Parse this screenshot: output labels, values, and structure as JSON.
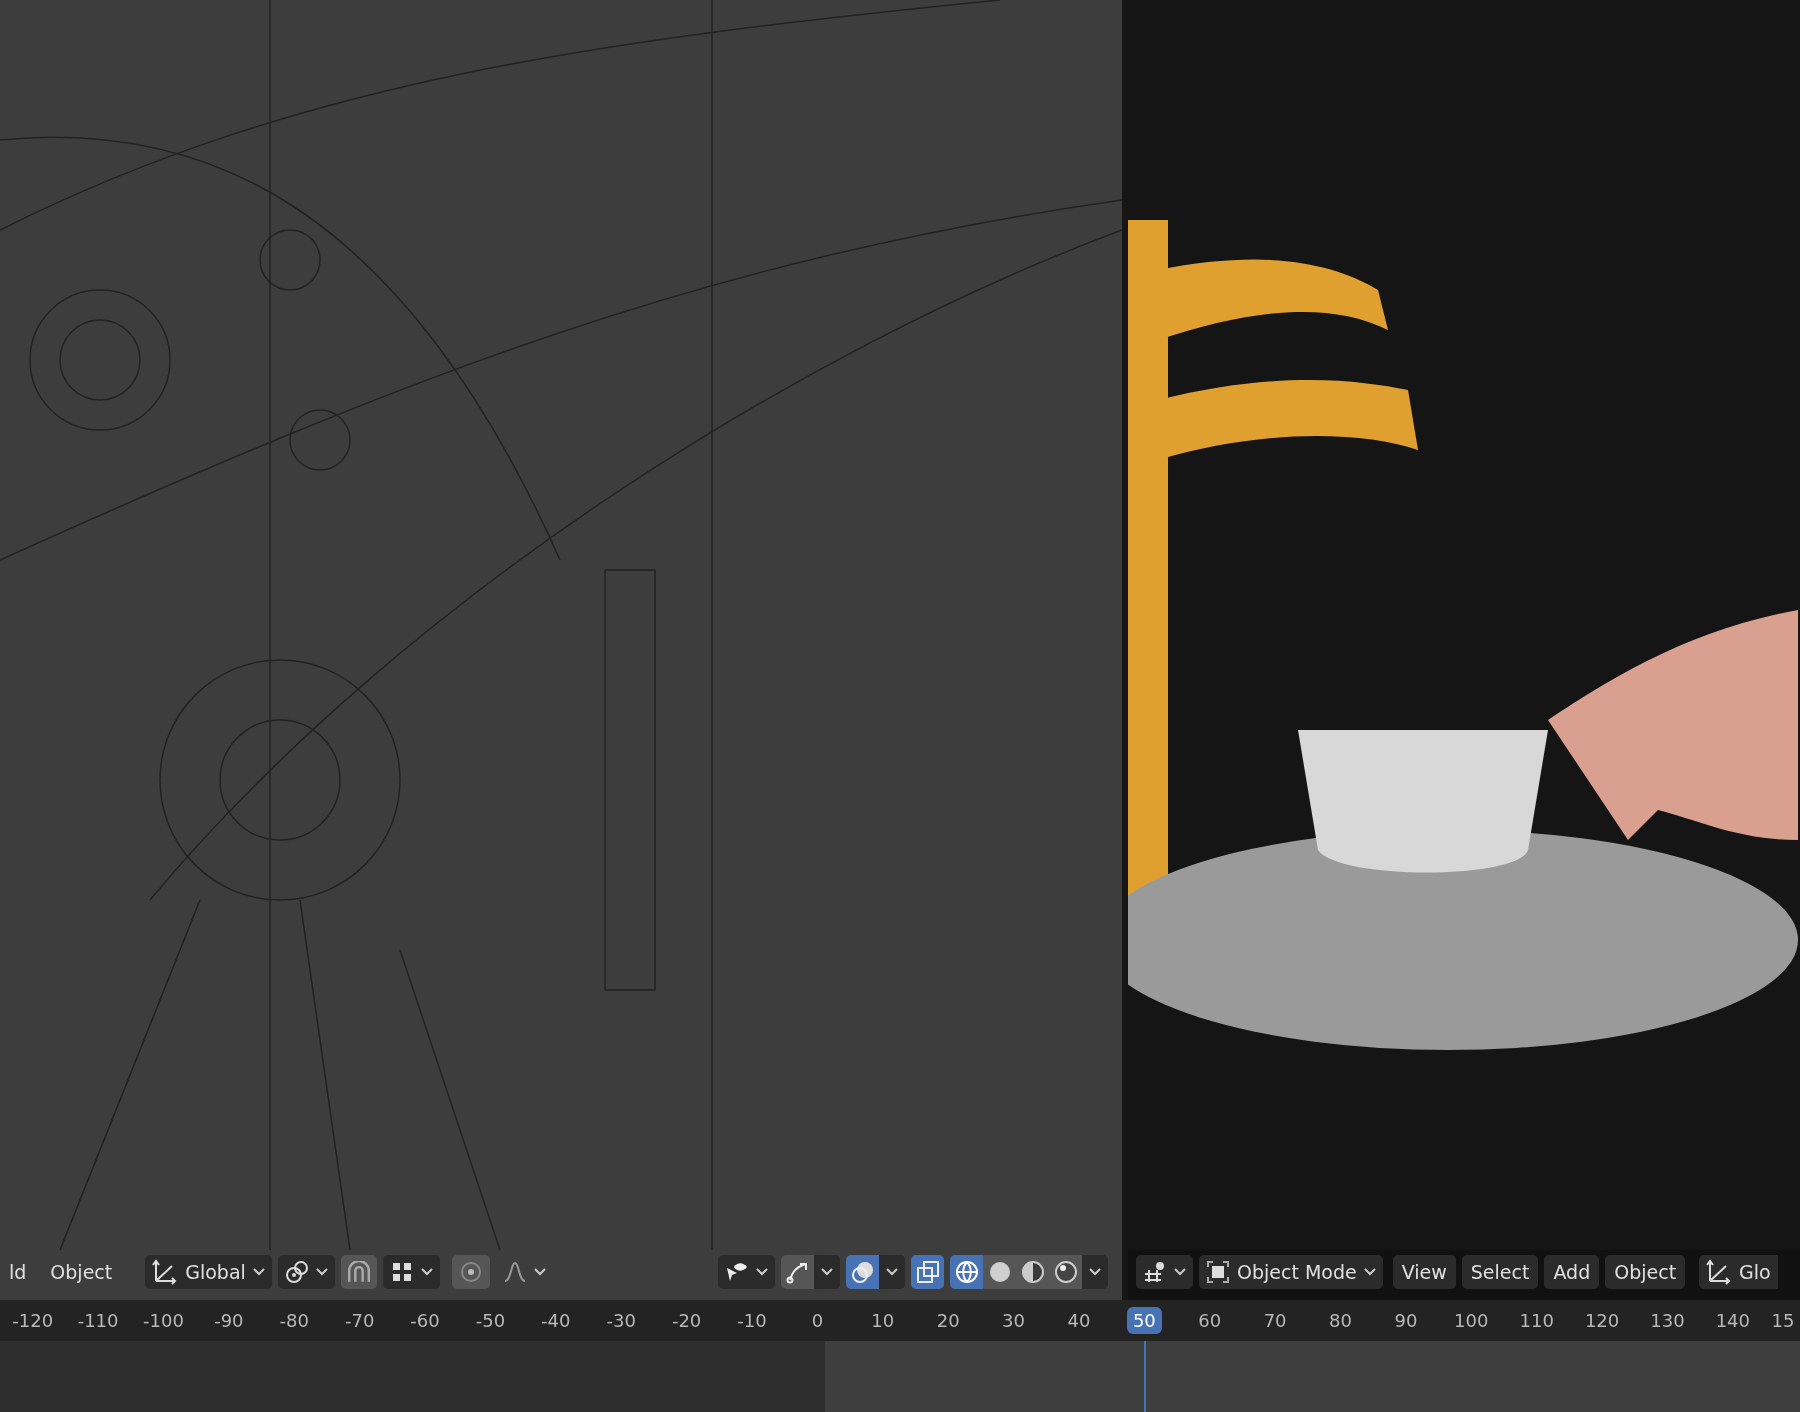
{
  "left_viewport": {
    "header": {
      "menus": [
        {
          "label": "ld"
        },
        {
          "label": "Object"
        }
      ],
      "orientation": {
        "label": "Global"
      },
      "overlays": {
        "on": true
      },
      "xray": {
        "on": true
      },
      "shading_modes": [
        {
          "kind": "wireframe",
          "selected": true
        },
        {
          "kind": "solid",
          "selected": false
        },
        {
          "kind": "material",
          "selected": false
        },
        {
          "kind": "rendered",
          "selected": false
        }
      ]
    }
  },
  "right_viewport": {
    "header": {
      "mode": {
        "label": "Object Mode"
      },
      "menus": [
        {
          "label": "View"
        },
        {
          "label": "Select"
        },
        {
          "label": "Add"
        },
        {
          "label": "Object"
        }
      ],
      "orientation": {
        "label": "Glo"
      }
    }
  },
  "timeline": {
    "frames": [
      {
        "label": "-120",
        "selected": false
      },
      {
        "label": "-110",
        "selected": false
      },
      {
        "label": "-100",
        "selected": false
      },
      {
        "label": "-90",
        "selected": false
      },
      {
        "label": "-80",
        "selected": false
      },
      {
        "label": "-70",
        "selected": false
      },
      {
        "label": "-60",
        "selected": false
      },
      {
        "label": "-50",
        "selected": false
      },
      {
        "label": "-40",
        "selected": false
      },
      {
        "label": "-30",
        "selected": false
      },
      {
        "label": "-20",
        "selected": false
      },
      {
        "label": "-10",
        "selected": false
      },
      {
        "label": "0",
        "selected": false
      },
      {
        "label": "10",
        "selected": false
      },
      {
        "label": "20",
        "selected": false
      },
      {
        "label": "30",
        "selected": false
      },
      {
        "label": "40",
        "selected": false
      },
      {
        "label": "50",
        "selected": true
      },
      {
        "label": "60",
        "selected": false
      },
      {
        "label": "70",
        "selected": false
      },
      {
        "label": "80",
        "selected": false
      },
      {
        "label": "90",
        "selected": false
      },
      {
        "label": "100",
        "selected": false
      },
      {
        "label": "110",
        "selected": false
      },
      {
        "label": "120",
        "selected": false
      },
      {
        "label": "130",
        "selected": false
      },
      {
        "label": "140",
        "selected": false
      },
      {
        "label": "15",
        "selected": false
      }
    ]
  }
}
